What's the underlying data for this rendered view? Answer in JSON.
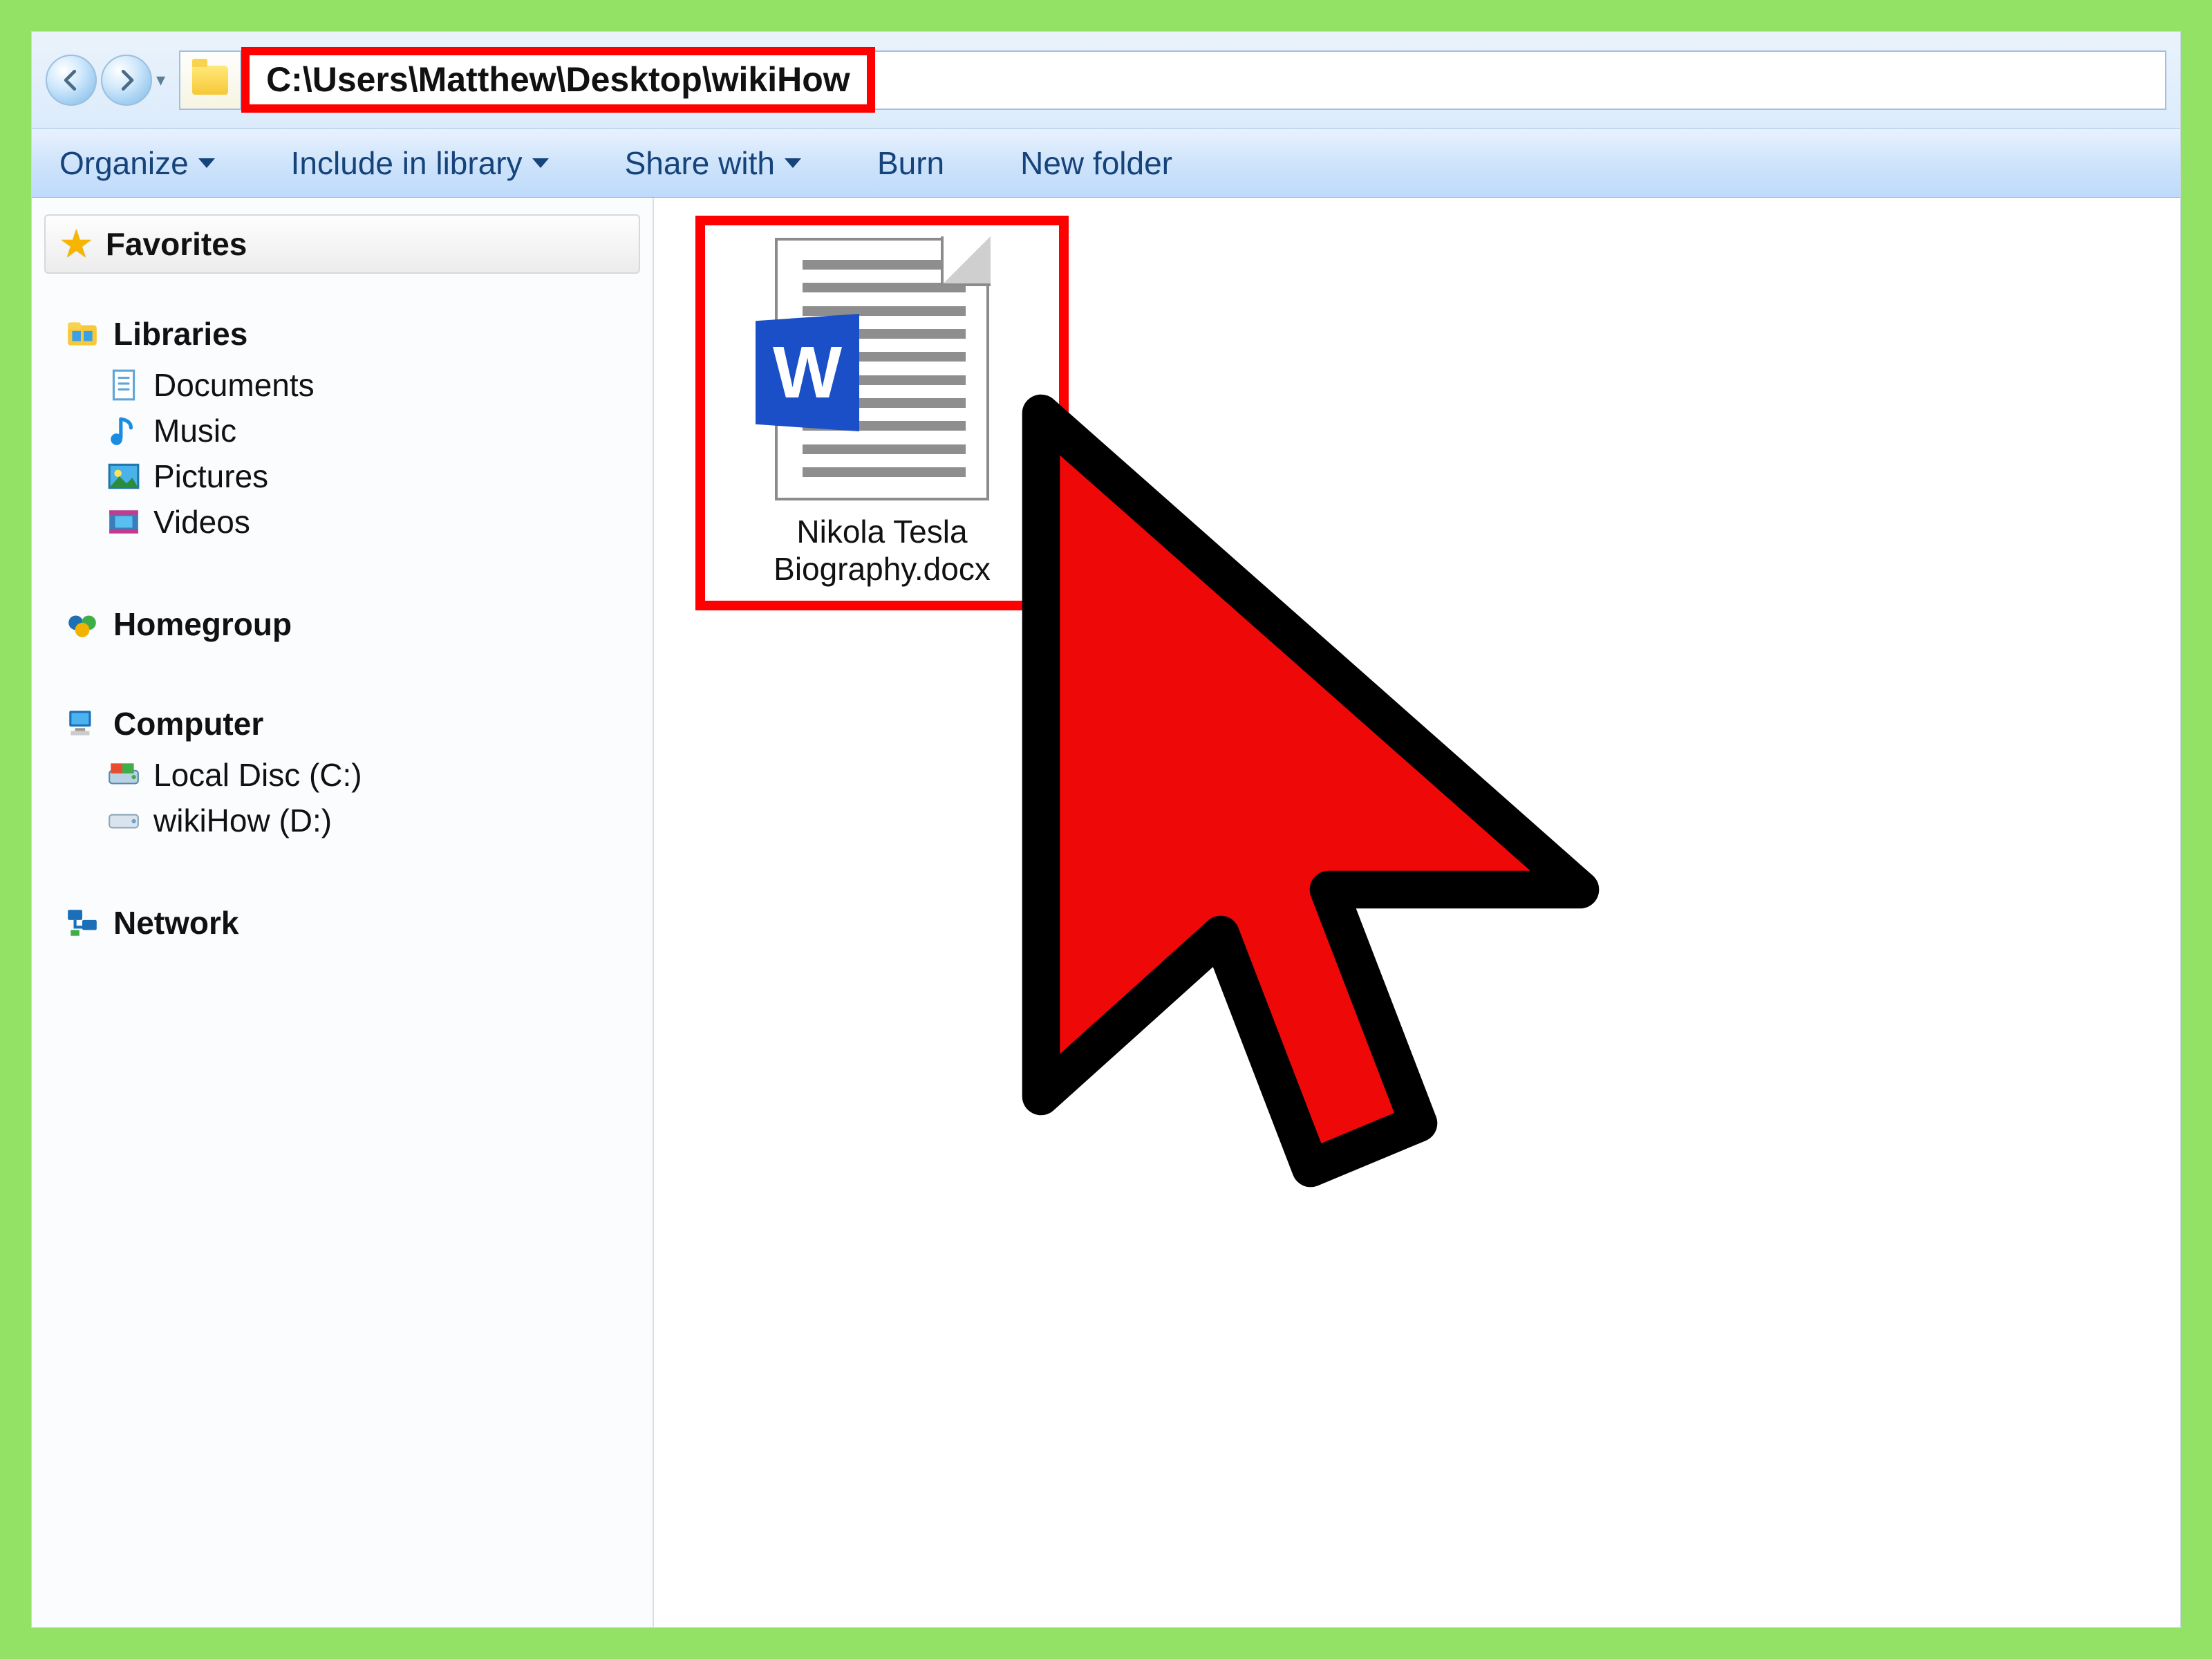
{
  "address": {
    "path": "C:\\Users\\Matthew\\Desktop\\wikiHow"
  },
  "toolbar": {
    "organize": "Organize",
    "include": "Include in library",
    "share": "Share with",
    "burn": "Burn",
    "newfolder": "New folder"
  },
  "sidebar": {
    "favorites": "Favorites",
    "libraries": "Libraries",
    "documents": "Documents",
    "music": "Music",
    "pictures": "Pictures",
    "videos": "Videos",
    "homegroup": "Homegroup",
    "computer": "Computer",
    "local_disc": "Local Disc (C:)",
    "wikihow_drive": "wikiHow (D:)",
    "network": "Network"
  },
  "file": {
    "name_line1": "Nikola Tesla",
    "name_line2": "Biography.docx"
  }
}
